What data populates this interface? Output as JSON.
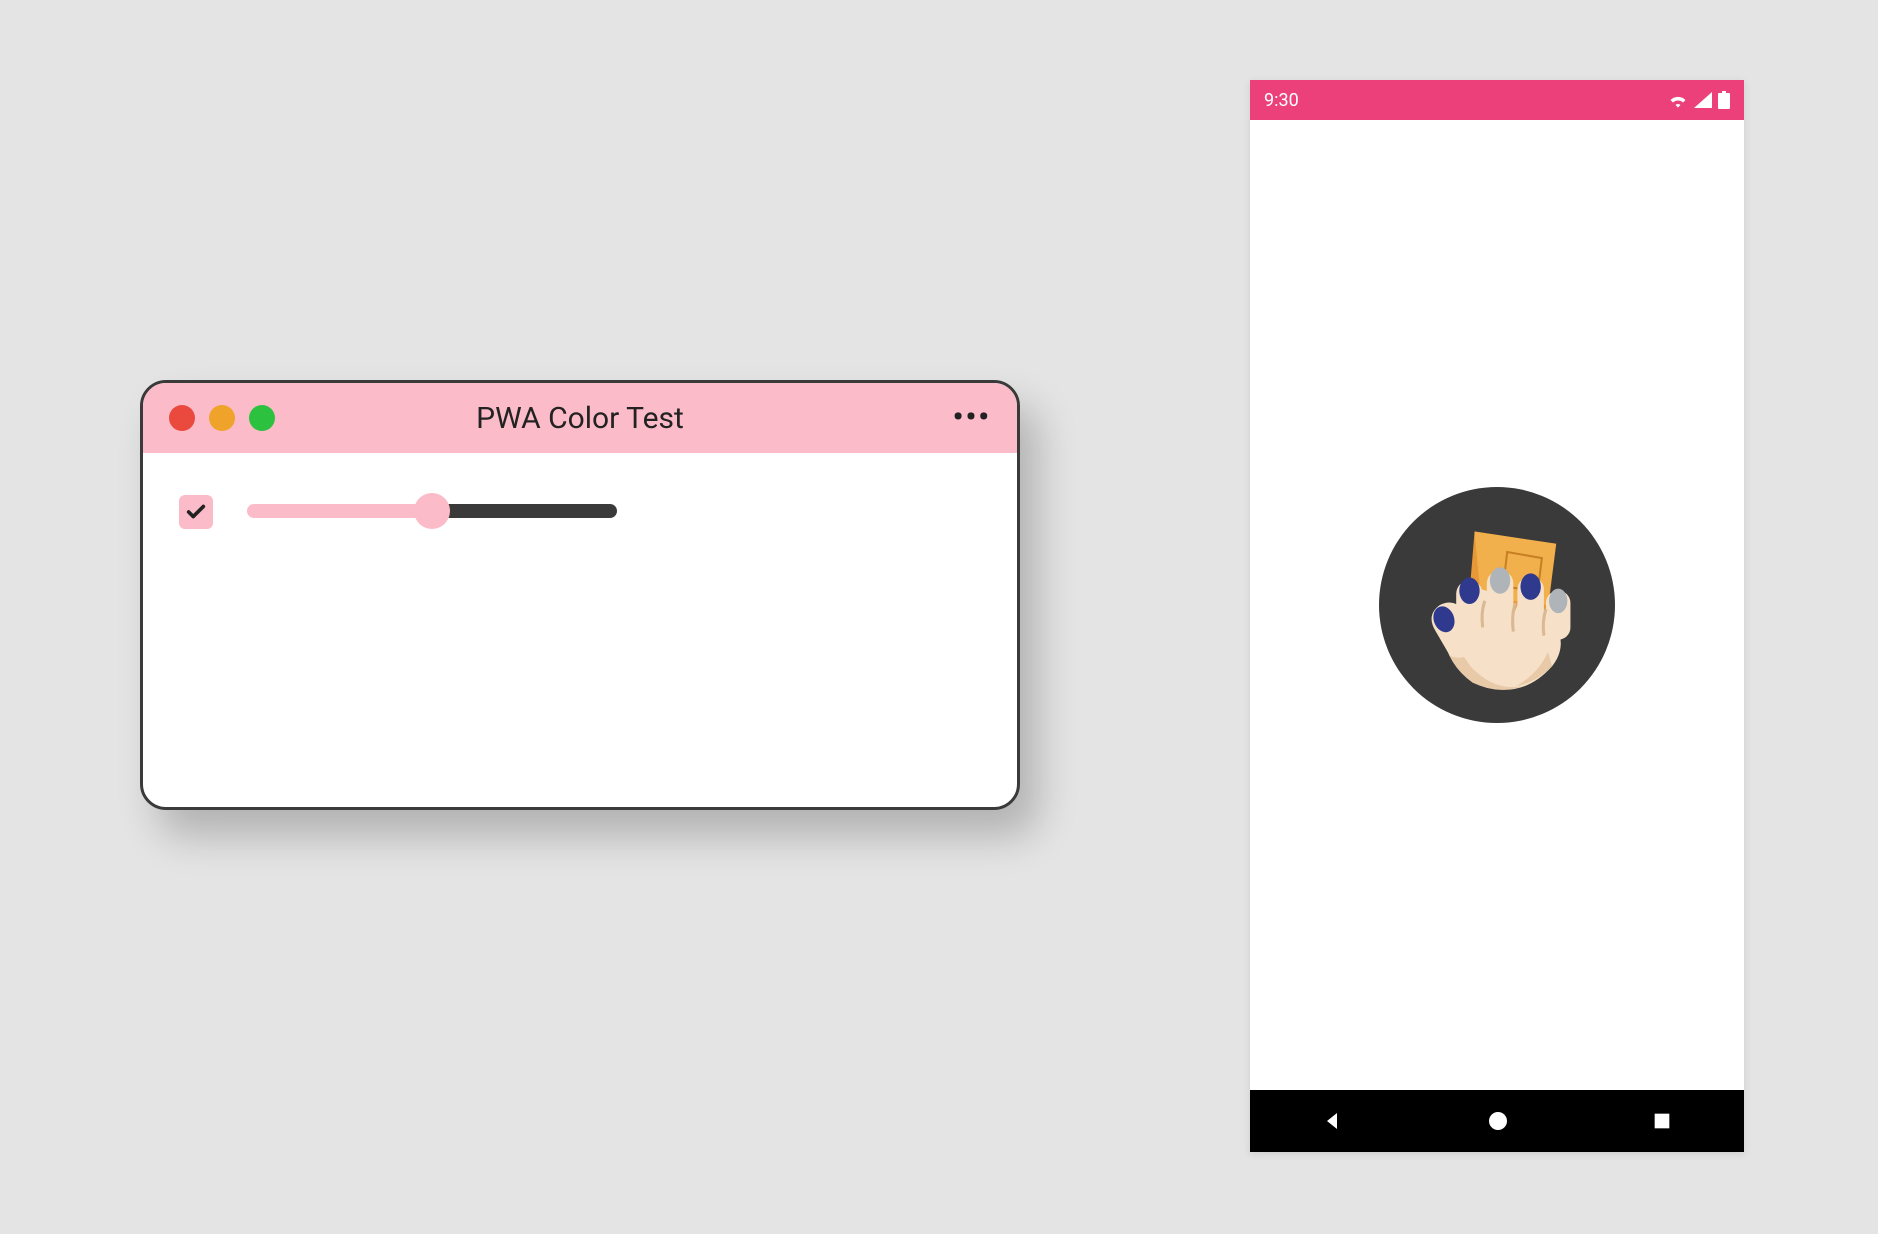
{
  "desktop_window": {
    "title": "PWA Color Test",
    "titlebar_color": "#fcbbc8",
    "accent_color": "#fcbbc8",
    "traffic_lights": {
      "close_color": "#ea493e",
      "minimize_color": "#f0a32b",
      "zoom_color": "#2dc140"
    },
    "more_button": "•••",
    "controls": {
      "checkbox_checked": true,
      "slider_percent": 50
    }
  },
  "phone": {
    "status_bar": {
      "time": "9:30",
      "bar_color": "#ec407a",
      "icons": [
        "wifi-icon",
        "signal-icon",
        "battery-icon"
      ]
    },
    "splash": {
      "background": "#ffffff",
      "icon_circle_color": "#3a3a3a",
      "icon_name": "squoosh-logo"
    },
    "nav_bar": {
      "bar_color": "#000000",
      "buttons": [
        "back",
        "home",
        "recents"
      ]
    }
  }
}
